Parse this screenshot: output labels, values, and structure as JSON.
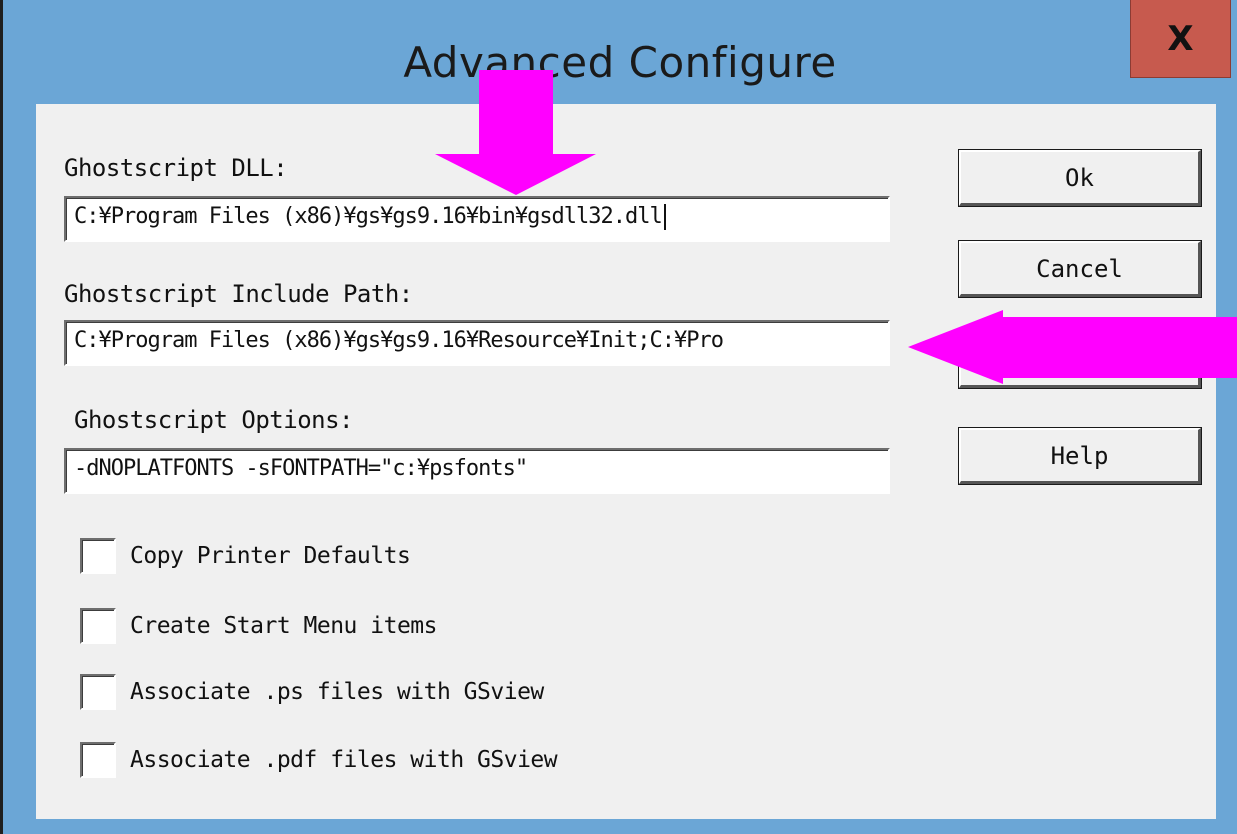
{
  "window": {
    "title": "Advanced Configure",
    "close_label": "X"
  },
  "fields": {
    "dll_label": "Ghostscript DLL:",
    "dll_value": "C:¥Program Files (x86)¥gs¥gs9.16¥bin¥gsdll32.dll",
    "include_label": "Ghostscript Include Path:",
    "include_value": "C:¥Program Files (x86)¥gs¥gs9.16¥Resource¥Init;C:¥Pro",
    "options_label": "Ghostscript Options:",
    "options_value": "-dNOPLATFONTS -sFONTPATH=\"c:¥psfonts\""
  },
  "buttons": {
    "ok": "Ok",
    "cancel": "Cancel",
    "help": "Help"
  },
  "checkboxes": [
    {
      "label": "Copy Printer Defaults",
      "checked": false
    },
    {
      "label": "Create Start Menu items",
      "checked": false
    },
    {
      "label": "Associate .ps files with GSview",
      "checked": false
    },
    {
      "label": "Associate .pdf files with GSview",
      "checked": false
    }
  ],
  "annotation_color": "#ff00ff"
}
